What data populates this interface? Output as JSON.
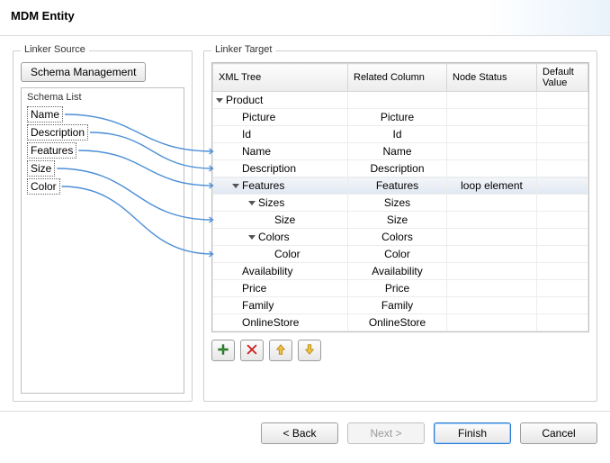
{
  "header": {
    "title": "MDM Entity"
  },
  "source": {
    "panel_title": "Linker Source",
    "schema_button": "Schema Management",
    "list_title": "Schema List",
    "items": [
      {
        "label": "Name"
      },
      {
        "label": "Description"
      },
      {
        "label": "Features"
      },
      {
        "label": "Size"
      },
      {
        "label": "Color"
      }
    ]
  },
  "target": {
    "panel_title": "Linker Target",
    "columns": {
      "c0": "XML Tree",
      "c1": "Related Column",
      "c2": "Node Status",
      "c3": "Default Value"
    },
    "rows": [
      {
        "depth": 0,
        "expand": true,
        "name": "Product",
        "related": "",
        "status": "",
        "selected": false
      },
      {
        "depth": 1,
        "expand": false,
        "name": "Picture",
        "related": "Picture",
        "status": "",
        "selected": false
      },
      {
        "depth": 1,
        "expand": false,
        "name": "Id",
        "related": "Id",
        "status": "",
        "selected": false
      },
      {
        "depth": 1,
        "expand": false,
        "name": "Name",
        "related": "Name",
        "status": "",
        "selected": false
      },
      {
        "depth": 1,
        "expand": false,
        "name": "Description",
        "related": "Description",
        "status": "",
        "selected": false
      },
      {
        "depth": 1,
        "expand": true,
        "name": "Features",
        "related": "Features",
        "status": "loop element",
        "selected": true
      },
      {
        "depth": 2,
        "expand": true,
        "name": "Sizes",
        "related": "Sizes",
        "status": "",
        "selected": false
      },
      {
        "depth": 3,
        "expand": false,
        "name": "Size",
        "related": "Size",
        "status": "",
        "selected": false
      },
      {
        "depth": 2,
        "expand": true,
        "name": "Colors",
        "related": "Colors",
        "status": "",
        "selected": false
      },
      {
        "depth": 3,
        "expand": false,
        "name": "Color",
        "related": "Color",
        "status": "",
        "selected": false
      },
      {
        "depth": 1,
        "expand": false,
        "name": "Availability",
        "related": "Availability",
        "status": "",
        "selected": false
      },
      {
        "depth": 1,
        "expand": false,
        "name": "Price",
        "related": "Price",
        "status": "",
        "selected": false
      },
      {
        "depth": 1,
        "expand": false,
        "name": "Family",
        "related": "Family",
        "status": "",
        "selected": false
      },
      {
        "depth": 1,
        "expand": false,
        "name": "OnlineStore",
        "related": "OnlineStore",
        "status": "",
        "selected": false
      }
    ],
    "toolbar": {
      "add": "add-icon",
      "remove": "remove-icon",
      "up": "arrow-up-icon",
      "down": "arrow-down-icon"
    }
  },
  "footer": {
    "back": "< Back",
    "next": "Next >",
    "finish": "Finish",
    "cancel": "Cancel"
  },
  "links": [
    {
      "from": 0,
      "to": 3
    },
    {
      "from": 1,
      "to": 4
    },
    {
      "from": 2,
      "to": 5
    },
    {
      "from": 3,
      "to": 7
    },
    {
      "from": 4,
      "to": 9
    }
  ]
}
